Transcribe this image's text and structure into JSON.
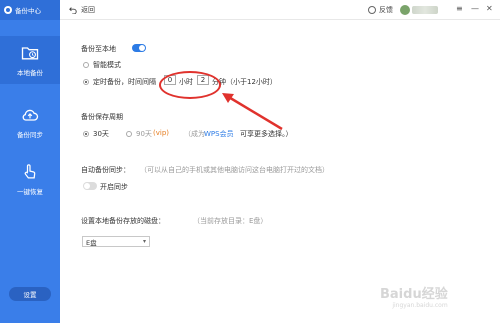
{
  "sidebar": {
    "app_title": "备份中心",
    "items": [
      {
        "label": "本地备份"
      },
      {
        "label": "备份同步"
      },
      {
        "label": "一键恢复"
      }
    ],
    "settings_label": "设置"
  },
  "topbar": {
    "back_label": "返回",
    "feedback_label": "反馈",
    "window_controls": [
      "menu-icon",
      "minimize-icon",
      "close-icon"
    ]
  },
  "local_backup": {
    "heading": "备份至本地",
    "enabled": true,
    "option_smart": "智能模式",
    "option_timed_prefix": "定时备份，时间间隔",
    "hours_value": "0",
    "hours_unit": "小时",
    "minutes_value": "2",
    "minutes_unit": "分钟",
    "hint": "（小于12小时）"
  },
  "retention": {
    "heading": "备份保存周期",
    "option_30": "30天",
    "option_90": "90天",
    "vip_tag": "(vip)",
    "promo_prefix": "（成为",
    "promo_link": "WPS会员",
    "promo_suffix": "可享更多选择。）"
  },
  "auto_backup": {
    "heading": "自动备份同步：",
    "description": "（可以从自己的手机或其他电脑访问这台电脑打开过的文档）",
    "toggle_label": "开启同步",
    "enabled": false
  },
  "disk": {
    "heading": "设置本地备份存放的磁盘：",
    "current_hint": "（当前存放目录：E盘）",
    "selected": "E盘"
  },
  "watermark": {
    "brand": "Baidu经验",
    "url": "jingyan.baidu.com"
  },
  "colors": {
    "sidebar": "#3a7ee9",
    "accent": "#2c7be5",
    "annotation": "#e0322d"
  }
}
